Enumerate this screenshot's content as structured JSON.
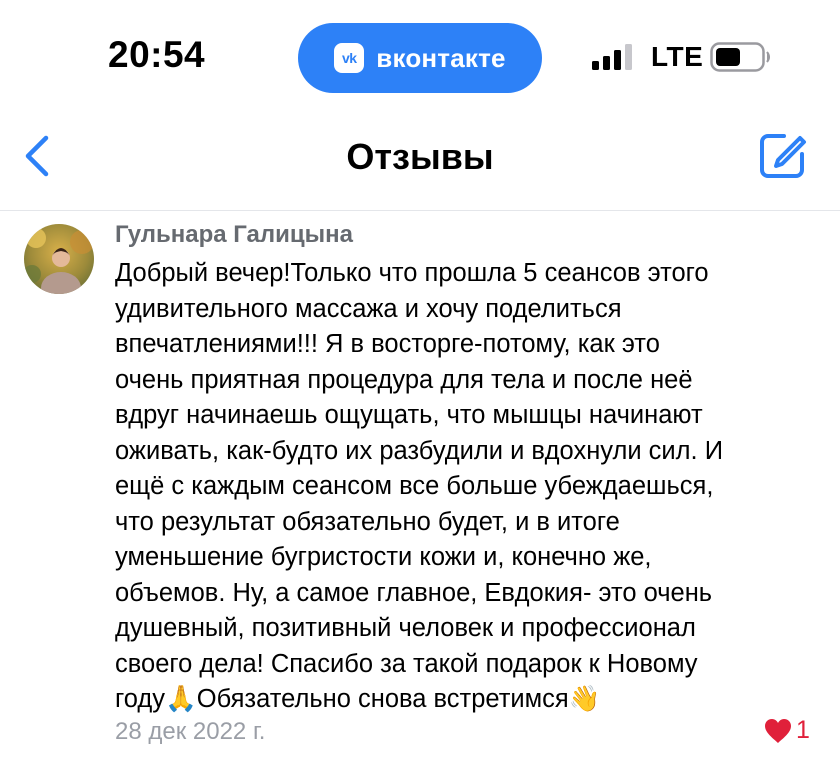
{
  "status_bar": {
    "time": "20:54",
    "app_badge": "вконтакте",
    "app_logo": "vk",
    "network": "LTE"
  },
  "nav": {
    "title": "Отзывы",
    "back_icon": "chevron-left-icon",
    "edit_icon": "compose-icon"
  },
  "review": {
    "author": "Гульнара Галицына",
    "text": "Добрый вечер!Только что прошла 5 сеансов этого\nудивительного массажа и хочу поделиться\nвпечатлениями!!! Я в восторге-потому, как это\nочень приятная процедура для тела и после неё\nвдруг начинаешь ощущать, что мышцы начинают\nоживать, как-будто их разбудили и вдохнули сил. И\nещё с каждым сеансом все больше убеждаешься,\nчто результат обязательно будет, и в итоге\nуменьшение бугристости кожи и, конечно же,\nобъемов. Ну, а самое главное, Евдокия- это очень\nдушевный, позитивный человек и профессионал\nсвоего дела! Спасибо за такой подарок к Новому\nгоду🙏Обязательно снова встретимся👋",
    "date": "28 дек 2022 г.",
    "likes": "1"
  },
  "colors": {
    "accent": "#2d81f7",
    "author": "#666a70",
    "date": "#9a9ea6",
    "like": "#e0203a"
  }
}
